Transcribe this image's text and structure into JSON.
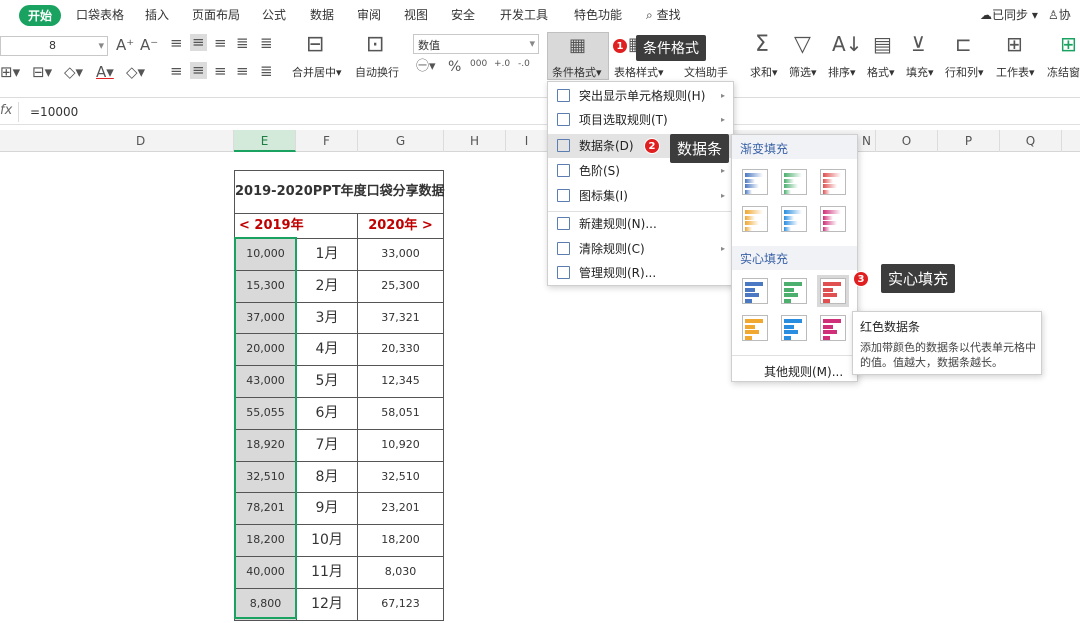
{
  "menubar": {
    "tabs": [
      "开始",
      "口袋表格",
      "插入",
      "页面布局",
      "公式",
      "数据",
      "审阅",
      "视图",
      "安全",
      "开发工具",
      "特色功能",
      "查找"
    ],
    "sync": "已同步",
    "share": "协"
  },
  "ribbon": {
    "font_size": "8",
    "number_format": "数值",
    "merge": "合并居中",
    "wrap": "自动换行",
    "cond_format": "条件格式",
    "table_style": "表格样式",
    "doc_helper": "文档助手",
    "sum": "求和",
    "filter": "筛选",
    "sort": "排序",
    "format": "格式",
    "fill": "填充",
    "rowcol": "行和列",
    "sheet": "工作表",
    "freeze": "冻结窗"
  },
  "formula_bar": {
    "fx": "fx",
    "value": "=10000"
  },
  "columns": [
    "D",
    "E",
    "F",
    "G",
    "H",
    "I",
    "N",
    "O",
    "P",
    "Q"
  ],
  "table": {
    "title": "2019-2020PPT年度口袋分享数据",
    "prev": "< 2019年",
    "next": "2020年 >",
    "rows": [
      {
        "a": "10,000",
        "m": "1月",
        "b": "33,000"
      },
      {
        "a": "15,300",
        "m": "2月",
        "b": "25,300"
      },
      {
        "a": "37,000",
        "m": "3月",
        "b": "37,321"
      },
      {
        "a": "20,000",
        "m": "4月",
        "b": "20,330"
      },
      {
        "a": "43,000",
        "m": "5月",
        "b": "12,345"
      },
      {
        "a": "55,055",
        "m": "6月",
        "b": "58,051"
      },
      {
        "a": "18,920",
        "m": "7月",
        "b": "10,920"
      },
      {
        "a": "32,510",
        "m": "8月",
        "b": "32,510"
      },
      {
        "a": "78,201",
        "m": "9月",
        "b": "23,201"
      },
      {
        "a": "18,200",
        "m": "10月",
        "b": "18,200"
      },
      {
        "a": "40,000",
        "m": "11月",
        "b": "8,030"
      },
      {
        "a": "8,800",
        "m": "12月",
        "b": "67,123"
      }
    ]
  },
  "cond_menu": {
    "items": [
      "突出显示单元格规则(H)",
      "项目选取规则(T)",
      "数据条(D)",
      "色阶(S)",
      "图标集(I)",
      "新建规则(N)...",
      "清除规则(C)",
      "管理规则(R)..."
    ]
  },
  "databar_panel": {
    "gradient": "渐变填充",
    "solid": "实心填充",
    "other": "其他规则(M)..."
  },
  "tooltip": {
    "title": "红色数据条",
    "body": "添加带颜色的数据条以代表单元格中的值。值越大，数据条越长。"
  },
  "callouts": [
    {
      "num": "1",
      "text": "条件格式"
    },
    {
      "num": "2",
      "text": "数据条"
    },
    {
      "num": "3",
      "text": "实心填充"
    }
  ],
  "colors": {
    "accent": "#1aa260",
    "red": "#c00000",
    "callout": "#3c3c3c"
  }
}
